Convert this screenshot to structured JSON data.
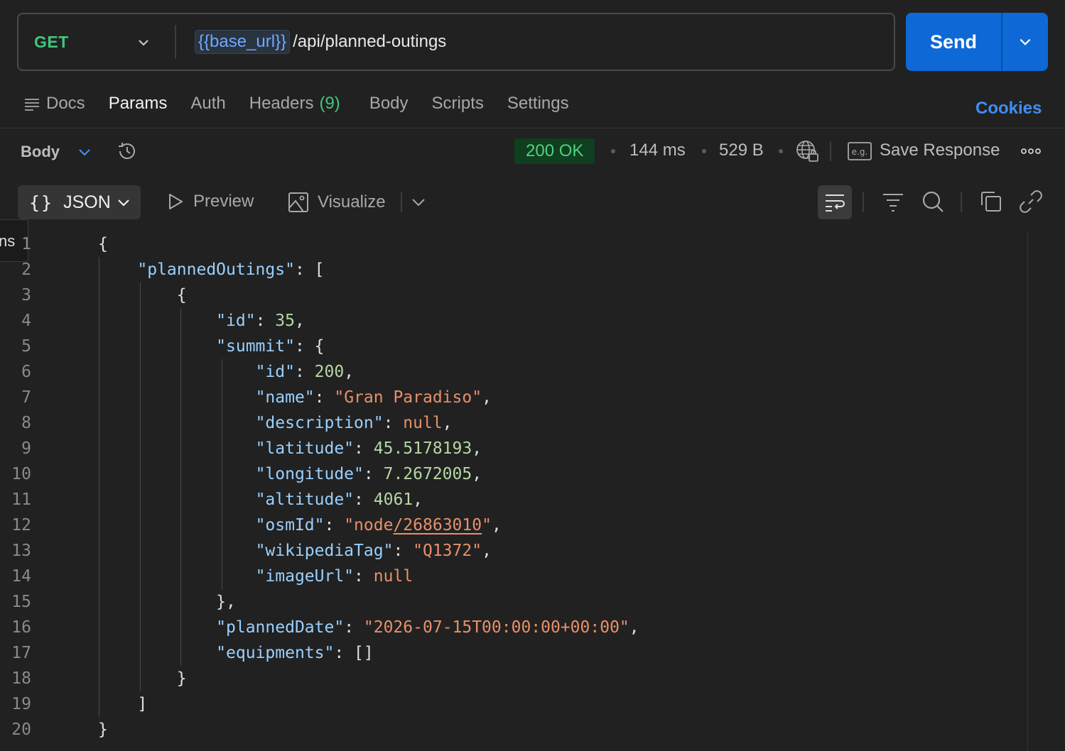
{
  "request": {
    "method": "GET",
    "url_variable": "{{base_url}}",
    "url_path": "/api/planned-outings",
    "send_label": "Send"
  },
  "tabs": [
    {
      "label": "Docs"
    },
    {
      "label": "Params"
    },
    {
      "label": "Auth"
    },
    {
      "label": "Headers",
      "count": "(9)"
    },
    {
      "label": "Body"
    },
    {
      "label": "Scripts"
    },
    {
      "label": "Settings"
    }
  ],
  "cookies_label": "Cookies",
  "response": {
    "view_label": "Body",
    "status": "200 OK",
    "time": "144 ms",
    "size": "529 B",
    "save_label": "Save Response"
  },
  "format": {
    "json_label": "JSON",
    "braces": "{}",
    "preview_label": "Preview",
    "visualize_label": "Visualize"
  },
  "side_tab_label": "ns",
  "code_lines": [
    "1",
    "2",
    "3",
    "4",
    "5",
    "6",
    "7",
    "8",
    "9",
    "10",
    "11",
    "12",
    "13",
    "14",
    "15",
    "16",
    "17",
    "18",
    "19",
    "20"
  ],
  "json_body": {
    "key_planned": "\"plannedOutings\"",
    "key_id": "\"id\"",
    "val_id": "35",
    "key_summit": "\"summit\"",
    "summit_id": "200",
    "key_name": "\"name\"",
    "val_name": "\"Gran Paradiso\"",
    "key_description": "\"description\"",
    "val_description": "null",
    "key_latitude": "\"latitude\"",
    "val_latitude": "45.5178193",
    "key_longitude": "\"longitude\"",
    "val_longitude": "7.2672005",
    "key_altitude": "\"altitude\"",
    "val_altitude": "4061",
    "key_osmId": "\"osmId\"",
    "val_osm_prefix": "\"node",
    "val_osm_link": "/26863010",
    "val_osm_suffix": "\"",
    "key_wikipedia": "\"wikipediaTag\"",
    "val_wikipedia": "\"Q1372\"",
    "key_imageUrl": "\"imageUrl\"",
    "val_imageUrl": "null",
    "key_plannedDate": "\"plannedDate\"",
    "val_plannedDate": "\"2026-07-15T00:00:00+00:00\"",
    "key_equipments": "\"equipments\"",
    "val_equipments": "[]"
  }
}
